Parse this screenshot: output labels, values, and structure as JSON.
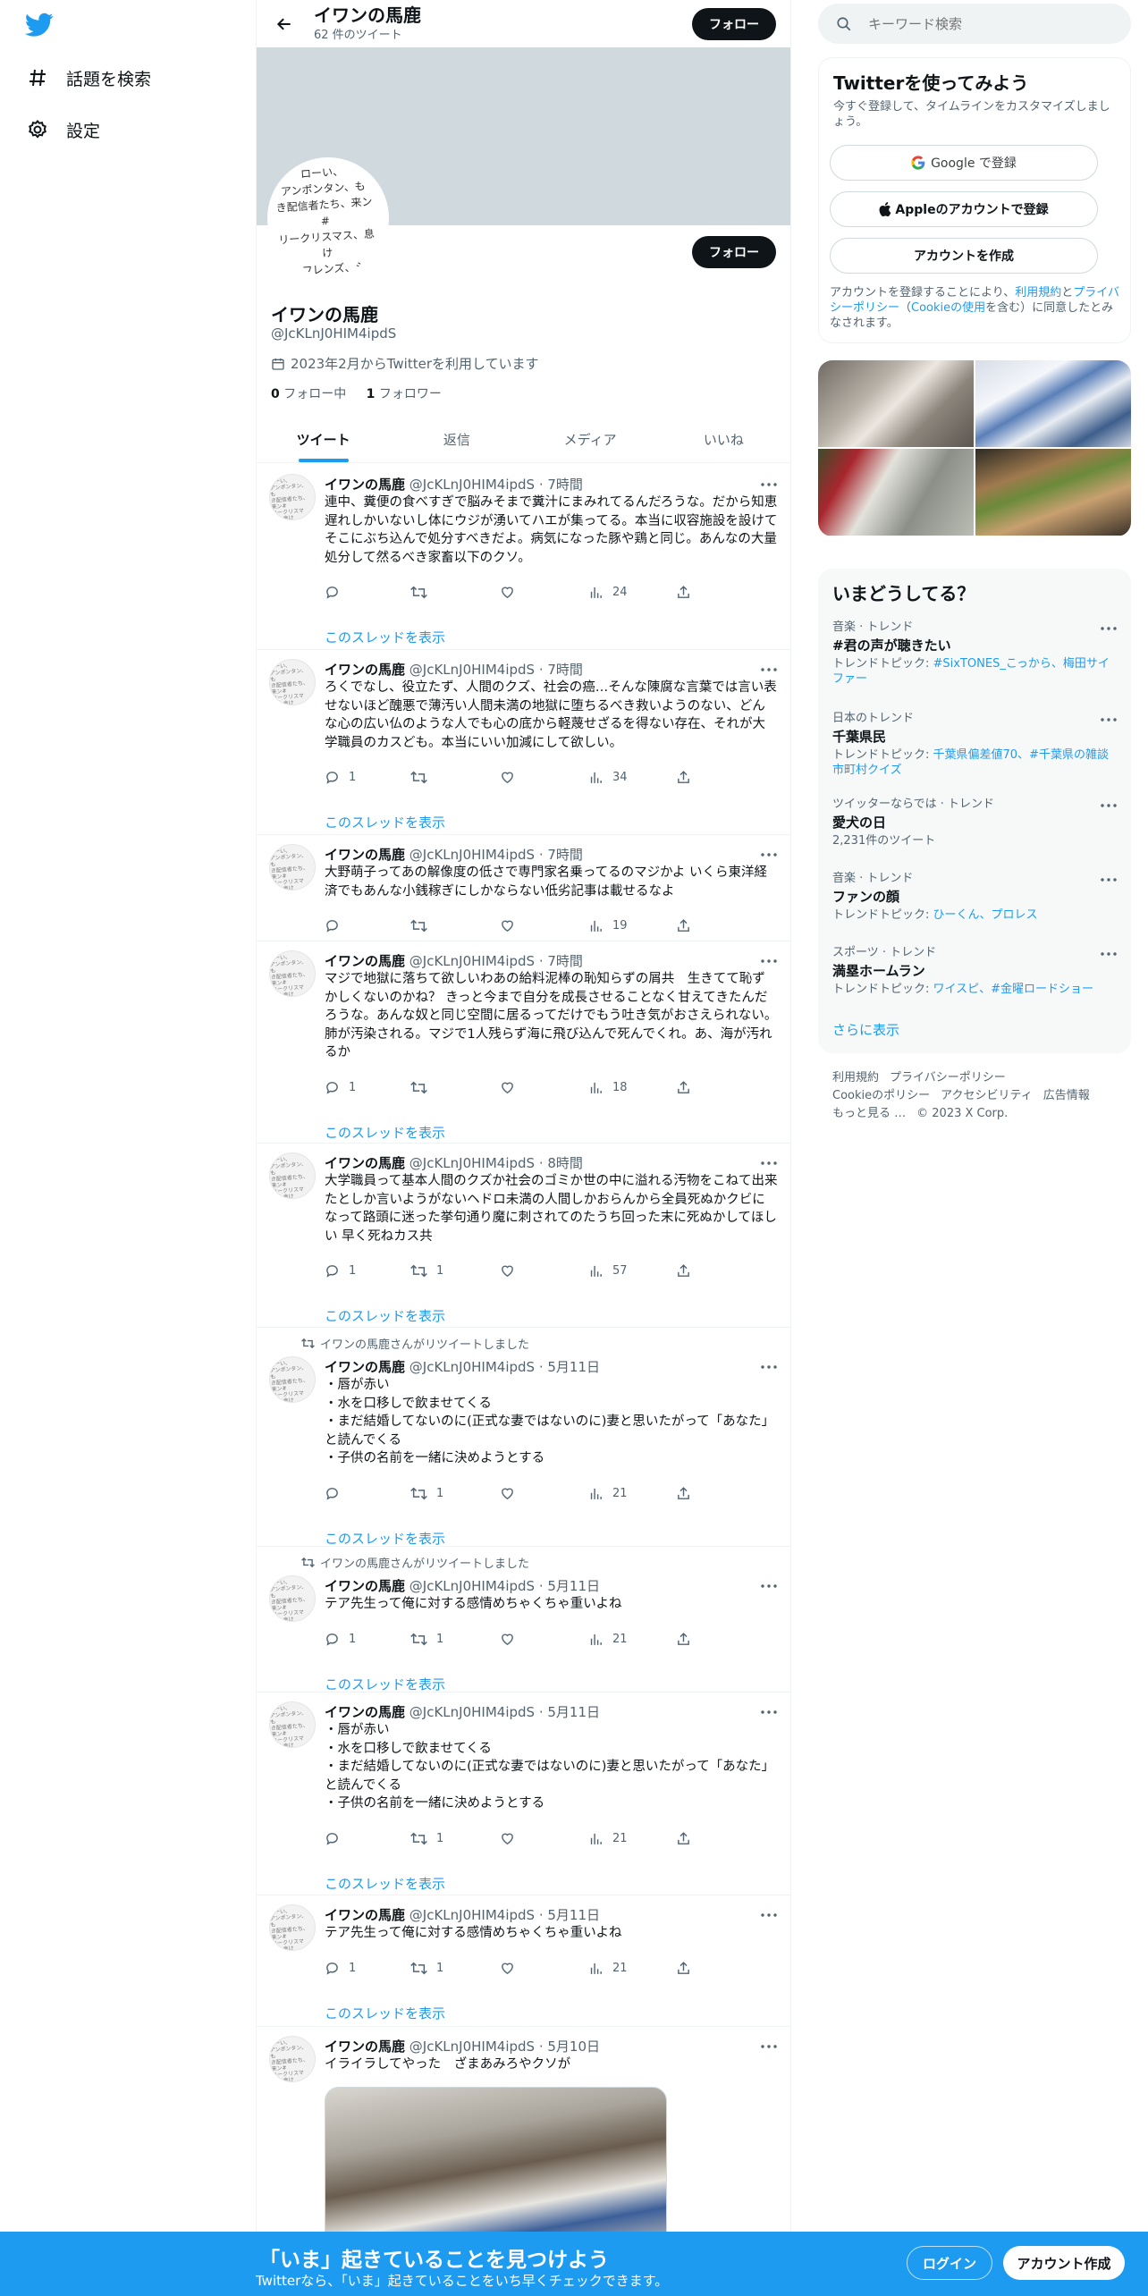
{
  "nav": {
    "explore_label": "話題を検索",
    "settings_label": "設定"
  },
  "header": {
    "name": "イワンの馬鹿",
    "tweet_count": "62 件のツイート",
    "follow_label": "フォロー"
  },
  "profile": {
    "name": "イワンの馬鹿",
    "handle": "@JcKLnJ0HIM4ipdS",
    "joined": "2023年2月からTwitterを利用しています",
    "following_count": "0",
    "following_label": "フォロー中",
    "followers_count": "1",
    "followers_label": "フォロワー",
    "follow_label": "フォロー",
    "avatar_text": "ローい、\nアンポンタン、も\nき配信者たち、来ン#\nリークリスマス、息け\nものフレンズ、シャム-\nじろう、グラップラー\n「イ」無職カーニバ\n゛ドげシャム#"
  },
  "tabs": [
    "ツイート",
    "返信",
    "メディア",
    "いいね"
  ],
  "thread_label": "このスレッドを表示",
  "tweets": [
    {
      "name": "イワンの馬鹿",
      "handle": "@JcKLnJ0HIM4ipdS",
      "time": "· 7時間",
      "text": "連中、糞便の食べすぎで脳みそまで糞汁にまみれてるんだろうな。だから知恵遅れしかいないし体にウジが湧いてハエが集ってる。本当に収容施設を設けてそこにぶち込んで処分すべきだよ。病気になった豚や鶏と同じ。あんなの大量処分して然るべき家畜以下のクソ。",
      "reply": "",
      "retweet": "",
      "like": "",
      "views": "24"
    },
    {
      "name": "イワンの馬鹿",
      "handle": "@JcKLnJ0HIM4ipdS",
      "time": "· 7時間",
      "text": "ろくでなし、役立たず、人間のクズ、社会の癌…そんな陳腐な言葉では言い表せないほど醜悪で薄汚い人間未満の地獄に堕ちるべき救いようのない、どんな心の広い仏のような人でも心の底から軽蔑せざるを得ない存在、それが大学職員のカスども。本当にいい加減にして欲しい。",
      "reply": "1",
      "retweet": "",
      "like": "",
      "views": "34"
    },
    {
      "name": "イワンの馬鹿",
      "handle": "@JcKLnJ0HIM4ipdS",
      "time": "· 7時間",
      "text": "大野萌子ってあの解像度の低さで専門家名乗ってるのマジかよ いくら東洋経済でもあんな小銭稼ぎにしかならない低劣記事は載せるなよ",
      "reply": "",
      "retweet": "",
      "like": "",
      "views": "19"
    },
    {
      "name": "イワンの馬鹿",
      "handle": "@JcKLnJ0HIM4ipdS",
      "time": "· 7時間",
      "text": "マジで地獄に落ちて欲しいわあの給料泥棒の恥知らずの屑共　生きてて恥ずかしくないのかね？ きっと今まで自分を成長させることなく甘えてきたんだろうな。あんな奴と同じ空間に居るってだけでもう吐き気がおさえられない。肺が汚染される。マジで1人残らず海に飛び込んで死んでくれ。あ、海が汚れるか",
      "reply": "1",
      "retweet": "",
      "like": "",
      "views": "18"
    },
    {
      "name": "イワンの馬鹿",
      "handle": "@JcKLnJ0HIM4ipdS",
      "time": "· 8時間",
      "text": "大学職員って基本人間のクズか社会のゴミか世の中に溢れる汚物をこねて出来たとしか言いようがないヘドロ未満の人間しかおらんから全員死ぬかクビになって路頭に迷った挙句通り魔に刺されてのたうち回った末に死ぬかしてほしい 早く死ねカス共",
      "reply": "1",
      "retweet": "1",
      "like": "",
      "views": "57"
    },
    {
      "retweeted_by": "イワンの馬鹿さんがリツイートしました",
      "name": "イワンの馬鹿",
      "handle": "@JcKLnJ0HIM4ipdS",
      "time": "· 5月11日",
      "text": "・唇が赤い\n・水を口移しで飲ませてくる\n・まだ結婚してないのに(正式な妻ではないのに)妻と思いたがって「あなた」と読んでくる\n・子供の名前を一緒に決めようとする",
      "reply": "",
      "retweet": "1",
      "like": "",
      "views": "21"
    },
    {
      "retweeted_by": "イワンの馬鹿さんがリツイートしました",
      "name": "イワンの馬鹿",
      "handle": "@JcKLnJ0HIM4ipdS",
      "time": "· 5月11日",
      "text": "テア先生って俺に対する感情めちゃくちゃ重いよね",
      "reply": "1",
      "retweet": "1",
      "like": "",
      "views": "21"
    },
    {
      "name": "イワンの馬鹿",
      "handle": "@JcKLnJ0HIM4ipdS",
      "time": "· 5月11日",
      "text": "・唇が赤い\n・水を口移しで飲ませてくる\n・まだ結婚してないのに(正式な妻ではないのに)妻と思いたがって「あなた」と読んでくる\n・子供の名前を一緒に決めようとする",
      "reply": "",
      "retweet": "1",
      "like": "",
      "views": "21"
    },
    {
      "name": "イワンの馬鹿",
      "handle": "@JcKLnJ0HIM4ipdS",
      "time": "· 5月11日",
      "text": "テア先生って俺に対する感情めちゃくちゃ重いよね",
      "reply": "1",
      "retweet": "1",
      "like": "",
      "views": "21"
    },
    {
      "name": "イワンの馬鹿",
      "handle": "@JcKLnJ0HIM4ipdS",
      "time": "· 5月10日",
      "text": "イライラしてやった　ざまあみろやクソが",
      "reply": "",
      "retweet": "",
      "like": "",
      "views": ""
    }
  ],
  "search": {
    "placeholder": "キーワード検索"
  },
  "signup": {
    "title": "Twitterを使ってみよう",
    "subtitle": "今すぐ登録して、タイムラインをカスタマイズしましょう。",
    "google_label": "Google で登録",
    "apple_label": "Appleのアカウントで登録",
    "create_label": "アカウントを作成",
    "legal_pre": "アカウントを登録することにより、",
    "legal_terms": "利用規約",
    "legal_and": "と",
    "legal_privacy": "プライバシーポリシー",
    "legal_open": "（",
    "legal_cookie": "Cookieの使用",
    "legal_post": "を含む）に同意したとみなされます。"
  },
  "trends": {
    "title": "いまどうしてる？",
    "items": [
      {
        "category": "音楽 · トレンド",
        "name": "#君の声が聴きたい",
        "topic_label": "トレンドトピック: ",
        "topics": "#SixTONES_こっから、梅田サイファー"
      },
      {
        "category": "日本のトレンド",
        "name": "千葉県民",
        "topic_label": "トレンドトピック: ",
        "topics": "千葉県偏差値70、#千葉県の雑談市町村クイズ"
      },
      {
        "category": "ツイッターならでは · トレンド",
        "name": "愛犬の日",
        "count": "2,231件のツイート"
      },
      {
        "category": "音楽 · トレンド",
        "name": "ファンの顔",
        "topic_label": "トレンドトピック: ",
        "topics": "ひーくん、プロレス"
      },
      {
        "category": "スポーツ · トレンド",
        "name": "満塁ホームラン",
        "topic_label": "トレンドトピック: ",
        "topics": "ワイスピ、#金曜ロードショー"
      }
    ],
    "more_label": "さらに表示"
  },
  "footer": {
    "items": [
      "利用規約",
      "プライバシーポリシー",
      "Cookieのポリシー",
      "アクセシビリティ",
      "広告情報",
      "もっと見る …",
      "© 2023 X Corp."
    ]
  },
  "bottom": {
    "title": "「いま」起きていることを見つけよう",
    "subtitle": "Twitterなら、「いま」起きていることをいち早くチェックできます。",
    "login_label": "ログイン",
    "signup_label": "アカウント作成"
  },
  "colors": {
    "accent": "#1d9bf0",
    "text": "#0f1419",
    "muted": "#536471",
    "banner": "#cfd9de"
  }
}
